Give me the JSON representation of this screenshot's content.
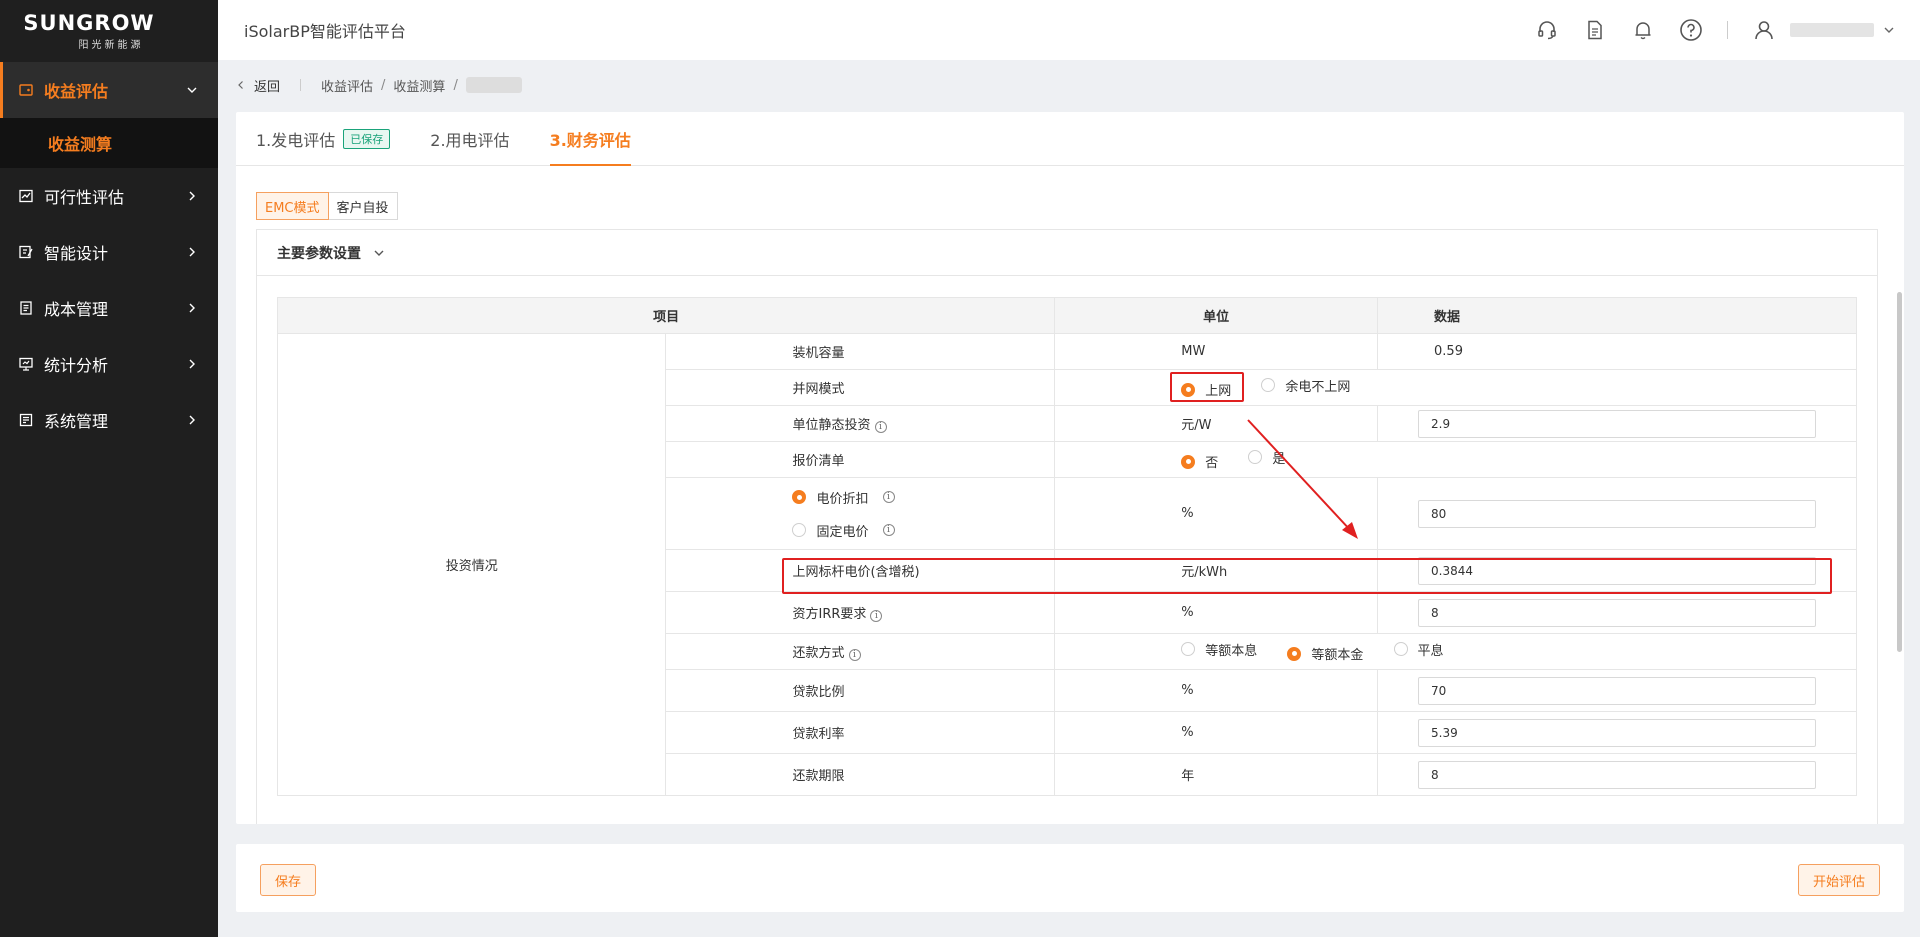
{
  "sidebar": {
    "logo": {
      "brand": "SUNGROW",
      "sub": "阳光新能源"
    },
    "items": [
      {
        "label": "收益评估",
        "icon": "wallet-icon",
        "active": true
      },
      {
        "label": "可行性评估",
        "icon": "chart-icon"
      },
      {
        "label": "智能设计",
        "icon": "design-icon"
      },
      {
        "label": "成本管理",
        "icon": "ledger-icon"
      },
      {
        "label": "统计分析",
        "icon": "monitor-icon"
      },
      {
        "label": "系统管理",
        "icon": "settings-panel-icon"
      }
    ],
    "sub_item": "收益测算"
  },
  "topbar": {
    "title": "iSolarBP智能评估平台",
    "icons": [
      "headset-icon",
      "document-icon",
      "bell-icon",
      "help-icon",
      "user-icon"
    ]
  },
  "breadcrumb": {
    "back": "返回",
    "items": [
      "收益评估",
      "收益测算"
    ]
  },
  "tabs": [
    {
      "label": "1.发电评估",
      "badge": "已保存"
    },
    {
      "label": "2.用电评估"
    },
    {
      "label": "3.财务评估",
      "active": true
    }
  ],
  "mode": {
    "options": [
      "EMC模式",
      "客户自投"
    ],
    "selected": "EMC模式"
  },
  "panel": {
    "title": "主要参数设置"
  },
  "table": {
    "headers": {
      "item": "项目",
      "unit": "单位",
      "data": "数据"
    },
    "group": "投资情况",
    "rows": {
      "capacity": {
        "label": "装机容量",
        "unit": "MW",
        "value": "0.59"
      },
      "grid_mode": {
        "label": "并网模式",
        "options": [
          "上网",
          "余电不上网"
        ],
        "selected": "上网"
      },
      "static_invest": {
        "label": "单位静态投资",
        "unit": "元/W",
        "value": "2.9"
      },
      "quote": {
        "label": "报价清单",
        "options": [
          "否",
          "是"
        ],
        "selected": "否"
      },
      "price_mode": {
        "options": [
          "电价折扣",
          "固定电价"
        ],
        "selected": "电价折扣",
        "unit": "%",
        "value": "80"
      },
      "benchmark": {
        "label": "上网标杆电价(含增税)",
        "unit": "元/kWh",
        "value": "0.3844"
      },
      "irr": {
        "label": "资方IRR要求",
        "unit": "%",
        "value": "8"
      },
      "repay": {
        "label": "还款方式",
        "options": [
          "等额本息",
          "等额本金",
          "平息"
        ],
        "selected": "等额本金"
      },
      "loan_ratio": {
        "label": "贷款比例",
        "unit": "%",
        "value": "70"
      },
      "loan_rate": {
        "label": "贷款利率",
        "unit": "%",
        "value": "5.39"
      },
      "loan_term": {
        "label": "还款期限",
        "unit": "年",
        "value": "8"
      }
    }
  },
  "footer": {
    "save": "保存",
    "start": "开始评估"
  },
  "colors": {
    "accent": "#f57d1f",
    "annotation": "#e02020",
    "sidebar": "#1f1f1f"
  }
}
